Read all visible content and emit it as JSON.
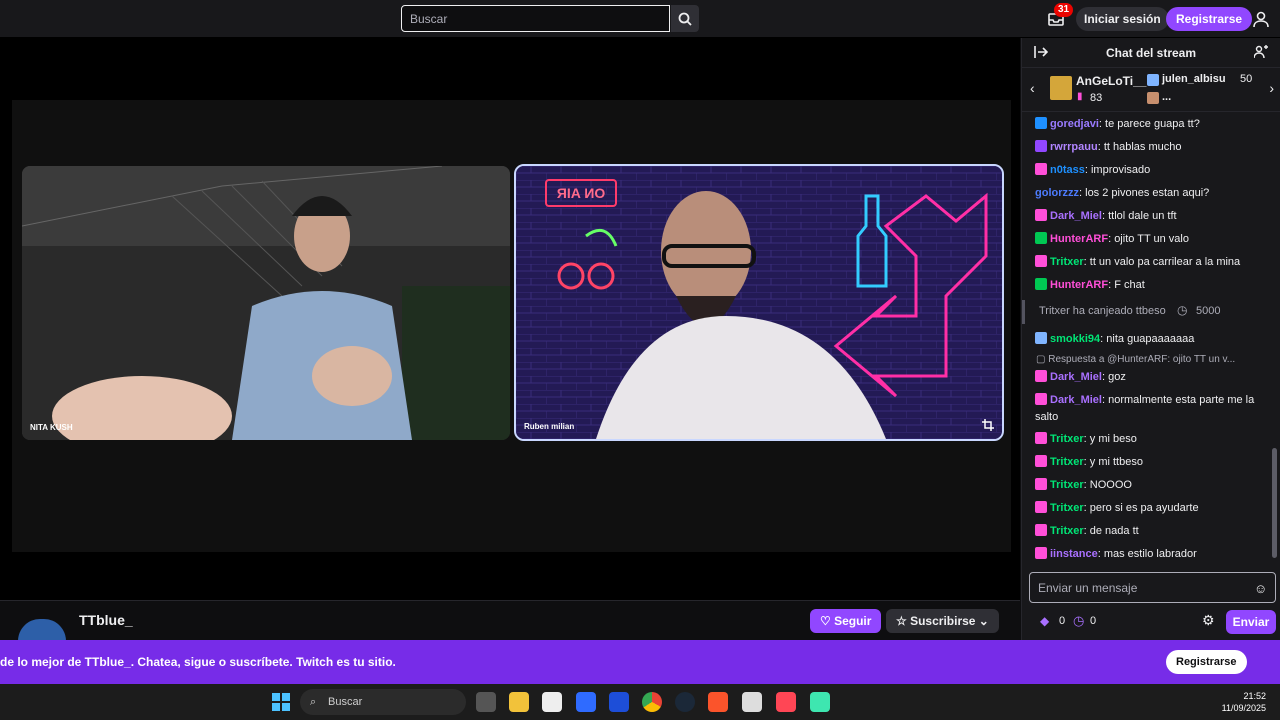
{
  "topbar": {
    "search_placeholder": "Buscar",
    "notifications_count": "31",
    "login_label": "Iniciar sesión",
    "register_label": "Registrarse"
  },
  "player": {
    "cam_left_label": "NITA KUSH",
    "cam_right_label": "Ruben milian",
    "neon_sign": "ON AIR"
  },
  "channel": {
    "name": "TTblue_",
    "follow_label": "Seguir",
    "subscribe_label": "Suscribirse"
  },
  "chat": {
    "title": "Chat del stream",
    "gifter1": {
      "name": "AnGeLoTi__",
      "count": "83"
    },
    "gifter2": {
      "name": "julen_albisu",
      "count": "50"
    },
    "gifter3_name": "...",
    "messages": [
      {
        "nick": "goredjavi",
        "text": "te parece guapa tt?",
        "color": "#9a7bff",
        "badge": "#1e90ff"
      },
      {
        "nick": "rwrrpauu",
        "text": "tt hablas mucho",
        "color": "#b185ff",
        "badge": "#9147ff"
      },
      {
        "nick": "n0tass",
        "text": "improvisado",
        "color": "#1e90ff",
        "badge": "#ff4fd8"
      },
      {
        "nick": "golorzzz",
        "text": "los 2 pivones estan aqui?",
        "color": "#4d7cff",
        "badge": ""
      },
      {
        "nick": "Dark_Miel",
        "text": "ttlol dale un tft",
        "color": "#a970ff",
        "badge": "#ff4fd8"
      },
      {
        "nick": "HunterARF",
        "text": "ojito TT un valo",
        "color": "#ff4fd8",
        "badge": "#00c853"
      },
      {
        "nick": "Tritxer",
        "text": "tt un valo pa carrilear a la mina",
        "color": "#00e676",
        "badge": "#ff4fd8"
      },
      {
        "nick": "HunterARF",
        "text": "F chat",
        "color": "#ff4fd8",
        "badge": "#00c853"
      },
      {
        "nick": "smokki94",
        "text": "nita guapaaaaaaa",
        "color": "#00e676",
        "badge": "#7fb4ff"
      },
      {
        "nick": "Dark_Miel",
        "text": "goz",
        "color": "#a970ff",
        "badge": "#ff4fd8"
      },
      {
        "nick": "Dark_Miel",
        "text": "normalmente esta parte me la salto",
        "color": "#a970ff",
        "badge": "#ff4fd8"
      },
      {
        "nick": "Tritxer",
        "text": "y mi beso",
        "color": "#00e676",
        "badge": "#ff4fd8"
      },
      {
        "nick": "Tritxer",
        "text": "y mi ttbeso",
        "color": "#00e676",
        "badge": "#ff4fd8"
      },
      {
        "nick": "Tritxer",
        "text": "NOOOO",
        "color": "#00e676",
        "badge": "#ff4fd8"
      },
      {
        "nick": "Tritxer",
        "text": "pero si es pa ayudarte",
        "color": "#00e676",
        "badge": "#ff4fd8"
      },
      {
        "nick": "Tritxer",
        "text": "de nada tt",
        "color": "#00e676",
        "badge": "#ff4fd8"
      },
      {
        "nick": "iinstance",
        "text": "mas estilo labrador",
        "color": "#a970ff",
        "badge": "#ff4fd8"
      }
    ],
    "redeem_text": "Tritxer ha canjeado ttbeso",
    "redeem_cost": "5000",
    "reply_text": "Respuesta a @HunterARF: ojito TT un v...",
    "input_placeholder": "Enviar un mensaje",
    "bits_count": "0",
    "points_count": "0",
    "send_label": "Enviar"
  },
  "banner": {
    "text": "de lo mejor de TTblue_.  Chatea, sigue o suscríbete. Twitch es tu sitio.",
    "button_label": "Registrarse"
  },
  "taskbar": {
    "search_label": "Buscar",
    "time": "21:52",
    "date": "11/09/2025"
  }
}
